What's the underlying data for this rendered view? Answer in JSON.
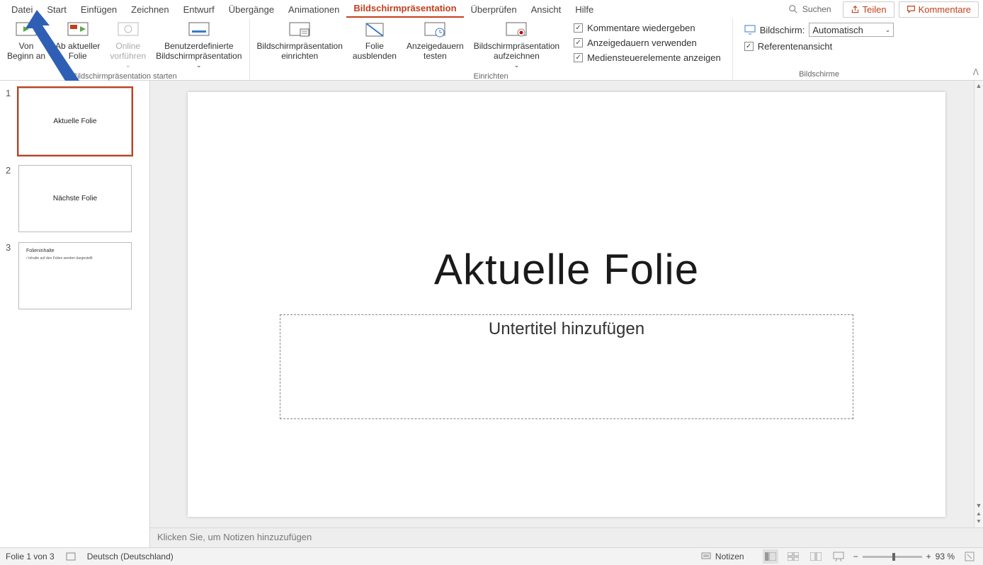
{
  "tabs": [
    "Datei",
    "Start",
    "Einfügen",
    "Zeichnen",
    "Entwurf",
    "Übergänge",
    "Animationen",
    "Bildschirmpräsentation",
    "Überprüfen",
    "Ansicht",
    "Hilfe"
  ],
  "active_tab": "Bildschirmpräsentation",
  "search_placeholder": "Suchen",
  "share_label": "Teilen",
  "comments_label": "Kommentare",
  "ribbon": {
    "group_start": {
      "label": "Bildschirmpräsentation starten",
      "from_begin": {
        "l1": "Von",
        "l2": "Beginn an"
      },
      "from_current": {
        "l1": "Ab aktueller",
        "l2": "Folie"
      },
      "online": {
        "l1": "Online",
        "l2": "vorführen"
      },
      "custom": {
        "l1": "Benutzerdefinierte",
        "l2": "Bildschirmpräsentation"
      }
    },
    "group_setup": {
      "label": "Einrichten",
      "setup": {
        "l1": "Bildschirmpräsentation",
        "l2": "einrichten"
      },
      "hide": {
        "l1": "Folie",
        "l2": "ausblenden"
      },
      "rehearse": {
        "l1": "Anzeigedauern",
        "l2": "testen"
      },
      "record": {
        "l1": "Bildschirmpräsentation",
        "l2": "aufzeichnen"
      },
      "chk1": "Kommentare wiedergeben",
      "chk2": "Anzeigedauern verwenden",
      "chk3": "Mediensteuerelemente anzeigen"
    },
    "group_monitors": {
      "label": "Bildschirme",
      "monitor_label": "Bildschirm:",
      "monitor_value": "Automatisch",
      "presenter": "Referentenansicht"
    }
  },
  "thumbs": [
    {
      "num": "1",
      "text": "Aktuelle Folie",
      "selected": true
    },
    {
      "num": "2",
      "text": "Nächste Folie",
      "selected": false
    },
    {
      "num": "3",
      "title": "Folieninhalte",
      "body": "• Inhalte auf den Folien werden dargestellt",
      "selected": false
    }
  ],
  "main_slide": {
    "title": "Aktuelle Folie",
    "subtitle": "Untertitel hinzufügen"
  },
  "notes_placeholder": "Klicken Sie, um Notizen hinzuzufügen",
  "status": {
    "slide": "Folie 1 von 3",
    "lang": "Deutsch (Deutschland)",
    "notes_btn": "Notizen",
    "zoom": "93 %"
  }
}
